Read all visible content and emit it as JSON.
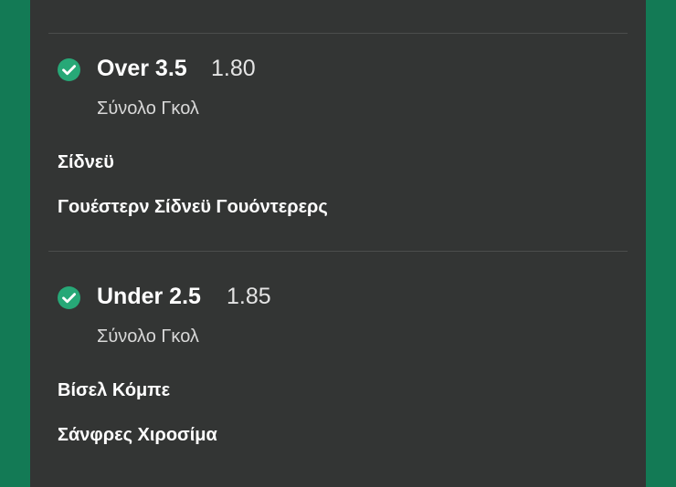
{
  "bets": [
    {
      "selection": "Over 3.5",
      "odds": "1.80",
      "market": "Σύνολο Γκολ",
      "home_team": "Σίδνεϋ",
      "away_team": "Γουέστερν Σίδνεϋ Γουόντερερς",
      "status_icon": "check-circle-icon"
    },
    {
      "selection": "Under 2.5",
      "odds": "1.85",
      "market": "Σύνολο Γκολ",
      "home_team": "Βίσελ Κόμπε",
      "away_team": "Σάνφρες Χιροσίμα",
      "status_icon": "check-circle-icon"
    }
  ],
  "colors": {
    "background": "#137a55",
    "panel": "#333534",
    "check": "#27a877",
    "divider": "#4b4d4c"
  }
}
